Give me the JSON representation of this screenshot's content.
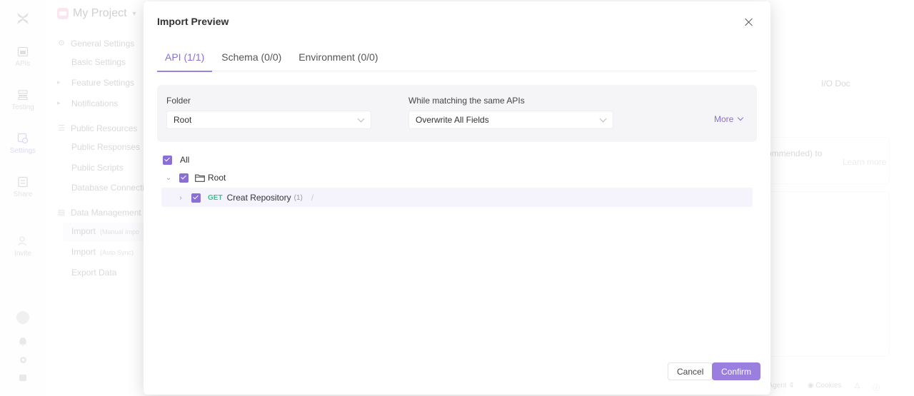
{
  "rail": {
    "items": [
      {
        "label": "APIs",
        "icon": "apis-icon"
      },
      {
        "label": "Testing",
        "icon": "testing-icon"
      },
      {
        "label": "Settings",
        "icon": "settings-icon"
      },
      {
        "label": "Share",
        "icon": "share-icon"
      },
      {
        "label": "Invite",
        "icon": "invite-icon"
      }
    ]
  },
  "sidebar": {
    "project": "My Project",
    "general_settings": "General Settings",
    "basic_settings": "Basic Settings",
    "feature_settings": "Feature Settings",
    "notifications": "Notifications",
    "public_resources": "Public Resources",
    "public_responses": "Public Responses",
    "public_scripts": "Public Scripts",
    "database_connections": "Database Connectio",
    "data_management": "Data Management",
    "import_manual": "Import",
    "import_manual_sub": "(Manual Impo",
    "import_auto": "Import",
    "import_auto_sub": "(Auto Sync)",
    "export_data": "Export Data"
  },
  "background": {
    "io_doc": "I/O Doc",
    "recommended_text": "ommended)  to",
    "learn_more": "Learn more",
    "footer_agent": "ect Agent ⇕",
    "footer_cookies": "Cookies"
  },
  "modal": {
    "title": "Import Preview",
    "tabs": [
      {
        "label": "API (1/1)",
        "active": true
      },
      {
        "label": "Schema (0/0)",
        "active": false
      },
      {
        "label": "Environment (0/0)",
        "active": false
      }
    ],
    "folder_label": "Folder",
    "folder_value": "Root",
    "matching_label": "While matching the same APIs",
    "matching_value": "Overwrite All Fields",
    "more_label": "More",
    "tree": {
      "all_label": "All",
      "root_label": "Root",
      "item": {
        "method": "GET",
        "name": "Creat Repository",
        "count": "(1)",
        "path": "/"
      }
    },
    "cancel_label": "Cancel",
    "confirm_label": "Confirm"
  },
  "colors": {
    "accent": "#8a6fd8",
    "get_method": "#3fbf8f",
    "confirm_bg": "#9b7fe0"
  }
}
